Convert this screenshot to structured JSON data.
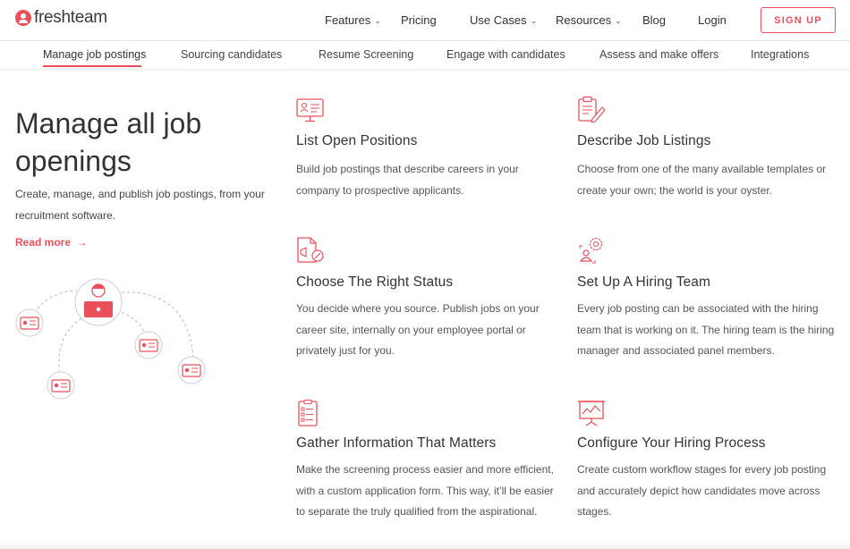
{
  "brand": {
    "name": "freshteam"
  },
  "nav": {
    "features": "Features",
    "pricing": "Pricing",
    "use_cases": "Use Cases",
    "resources": "Resources",
    "blog": "Blog",
    "login": "Login",
    "signup": "SIGN UP"
  },
  "subnav": {
    "tabs": [
      {
        "label": "Manage job postings",
        "active": true
      },
      {
        "label": "Sourcing candidates"
      },
      {
        "label": "Resume Screening"
      },
      {
        "label": "Engage with candidates"
      },
      {
        "label": "Assess and make offers"
      },
      {
        "label": "Integrations"
      }
    ]
  },
  "hero": {
    "title": "Manage all job openings",
    "subtitle": "Create, manage, and publish job postings, from your recruitment software.",
    "read_more": "Read more"
  },
  "features": [
    {
      "icon": "monitor-profile-icon",
      "title": "List Open Positions",
      "description": "Build job postings that describe careers in your company to prospective applicants."
    },
    {
      "icon": "clipboard-pen-icon",
      "title": "Describe Job Listings",
      "description": "Choose from one of the many available templates or create your own; the world is your oyster."
    },
    {
      "icon": "document-megaphone-icon",
      "title": "Choose The Right Status",
      "description": "You decide where you source. Publish jobs on your career site, internally on your employee portal or privately just for you."
    },
    {
      "icon": "team-gear-icon",
      "title": "Set Up A Hiring Team",
      "description": "Every job posting can be associated with the hiring team that is working on it. The hiring team is the hiring manager and associated panel members."
    },
    {
      "icon": "checklist-icon",
      "title": "Gather Information That Matters",
      "description": "Make the screening process easier and more efficient, with a custom application form. This way, it’ll be easier to separate the truly qualified from the aspirational."
    },
    {
      "icon": "presentation-board-icon",
      "title": "Configure Your Hiring Process",
      "description": "Create custom workflow stages for every job posting and accurately depict how candidates move across stages."
    }
  ],
  "colors": {
    "accent": "#e9505a",
    "text": "#333333",
    "muted": "#555555"
  }
}
